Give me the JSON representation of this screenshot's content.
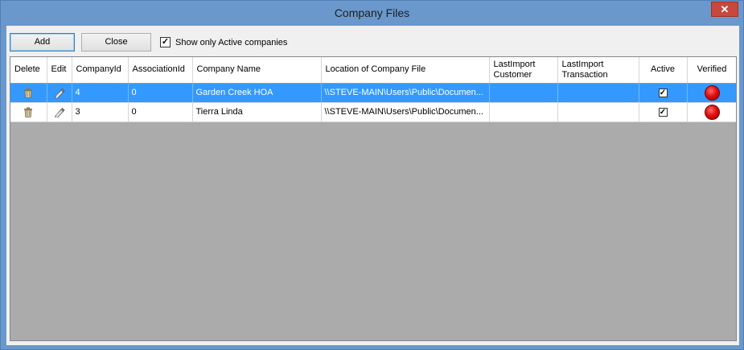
{
  "window": {
    "title": "Company Files",
    "close_glyph": "✕"
  },
  "toolbar": {
    "add_label": "Add",
    "close_label": "Close",
    "active_only_label": "Show only Active companies",
    "active_only_checked": true
  },
  "grid": {
    "columns": [
      {
        "key": "delete",
        "label": "Delete"
      },
      {
        "key": "edit",
        "label": "Edit"
      },
      {
        "key": "company_id",
        "label": "CompanyId"
      },
      {
        "key": "association_id",
        "label": "AssociationId"
      },
      {
        "key": "company_name",
        "label": "Company Name"
      },
      {
        "key": "location",
        "label": "Location of Company File"
      },
      {
        "key": "last_import_customer",
        "label": "LastImport Customer"
      },
      {
        "key": "last_import_transaction",
        "label": "LastImport Transaction"
      },
      {
        "key": "active",
        "label": "Active"
      },
      {
        "key": "verified",
        "label": "Verified"
      }
    ],
    "rows": [
      {
        "delete_icon": "trash-icon",
        "edit_icon": "pencil-icon",
        "company_id": "4",
        "association_id": "0",
        "company_name": "Garden Creek HOA",
        "location": "\\\\STEVE-MAIN\\Users\\Public\\Documen...",
        "last_import_customer": "",
        "last_import_transaction": "",
        "active": true,
        "verified_status": "red",
        "selected": true
      },
      {
        "delete_icon": "trash-icon",
        "edit_icon": "pencil-icon",
        "company_id": "3",
        "association_id": "0",
        "company_name": "Tierra Linda",
        "location": "\\\\STEVE-MAIN\\Users\\Public\\Documen...",
        "last_import_customer": "",
        "last_import_transaction": "",
        "active": true,
        "verified_status": "red",
        "selected": false
      }
    ]
  },
  "colors": {
    "selection": "#3399ff",
    "verified_red": "#e01010",
    "window_frame": "#6a98cc"
  }
}
